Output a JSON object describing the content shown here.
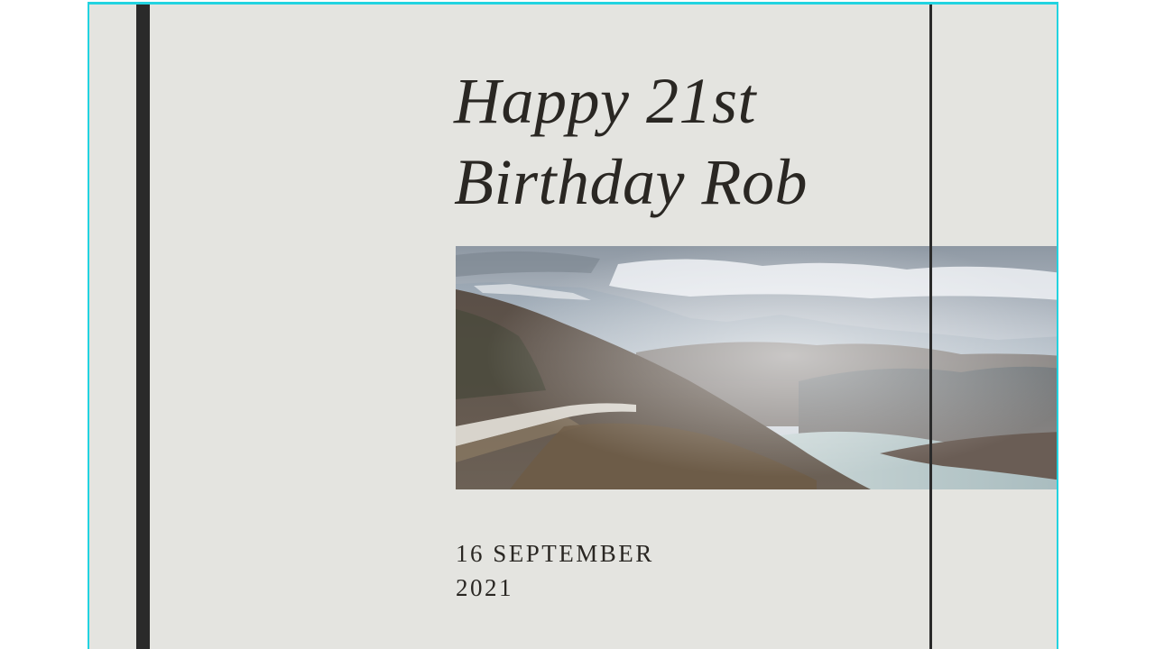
{
  "card": {
    "title_line1": "Happy 21st",
    "title_line2": "Birthday Rob",
    "date_line1": "16 SEPTEMBER",
    "date_line2": "2021",
    "photo_subject": "mountain road landscape"
  },
  "colors": {
    "background": "#e4e4e0",
    "text": "#2a2723",
    "bars": "#2a2a2a",
    "frame": "#22d3e0"
  }
}
